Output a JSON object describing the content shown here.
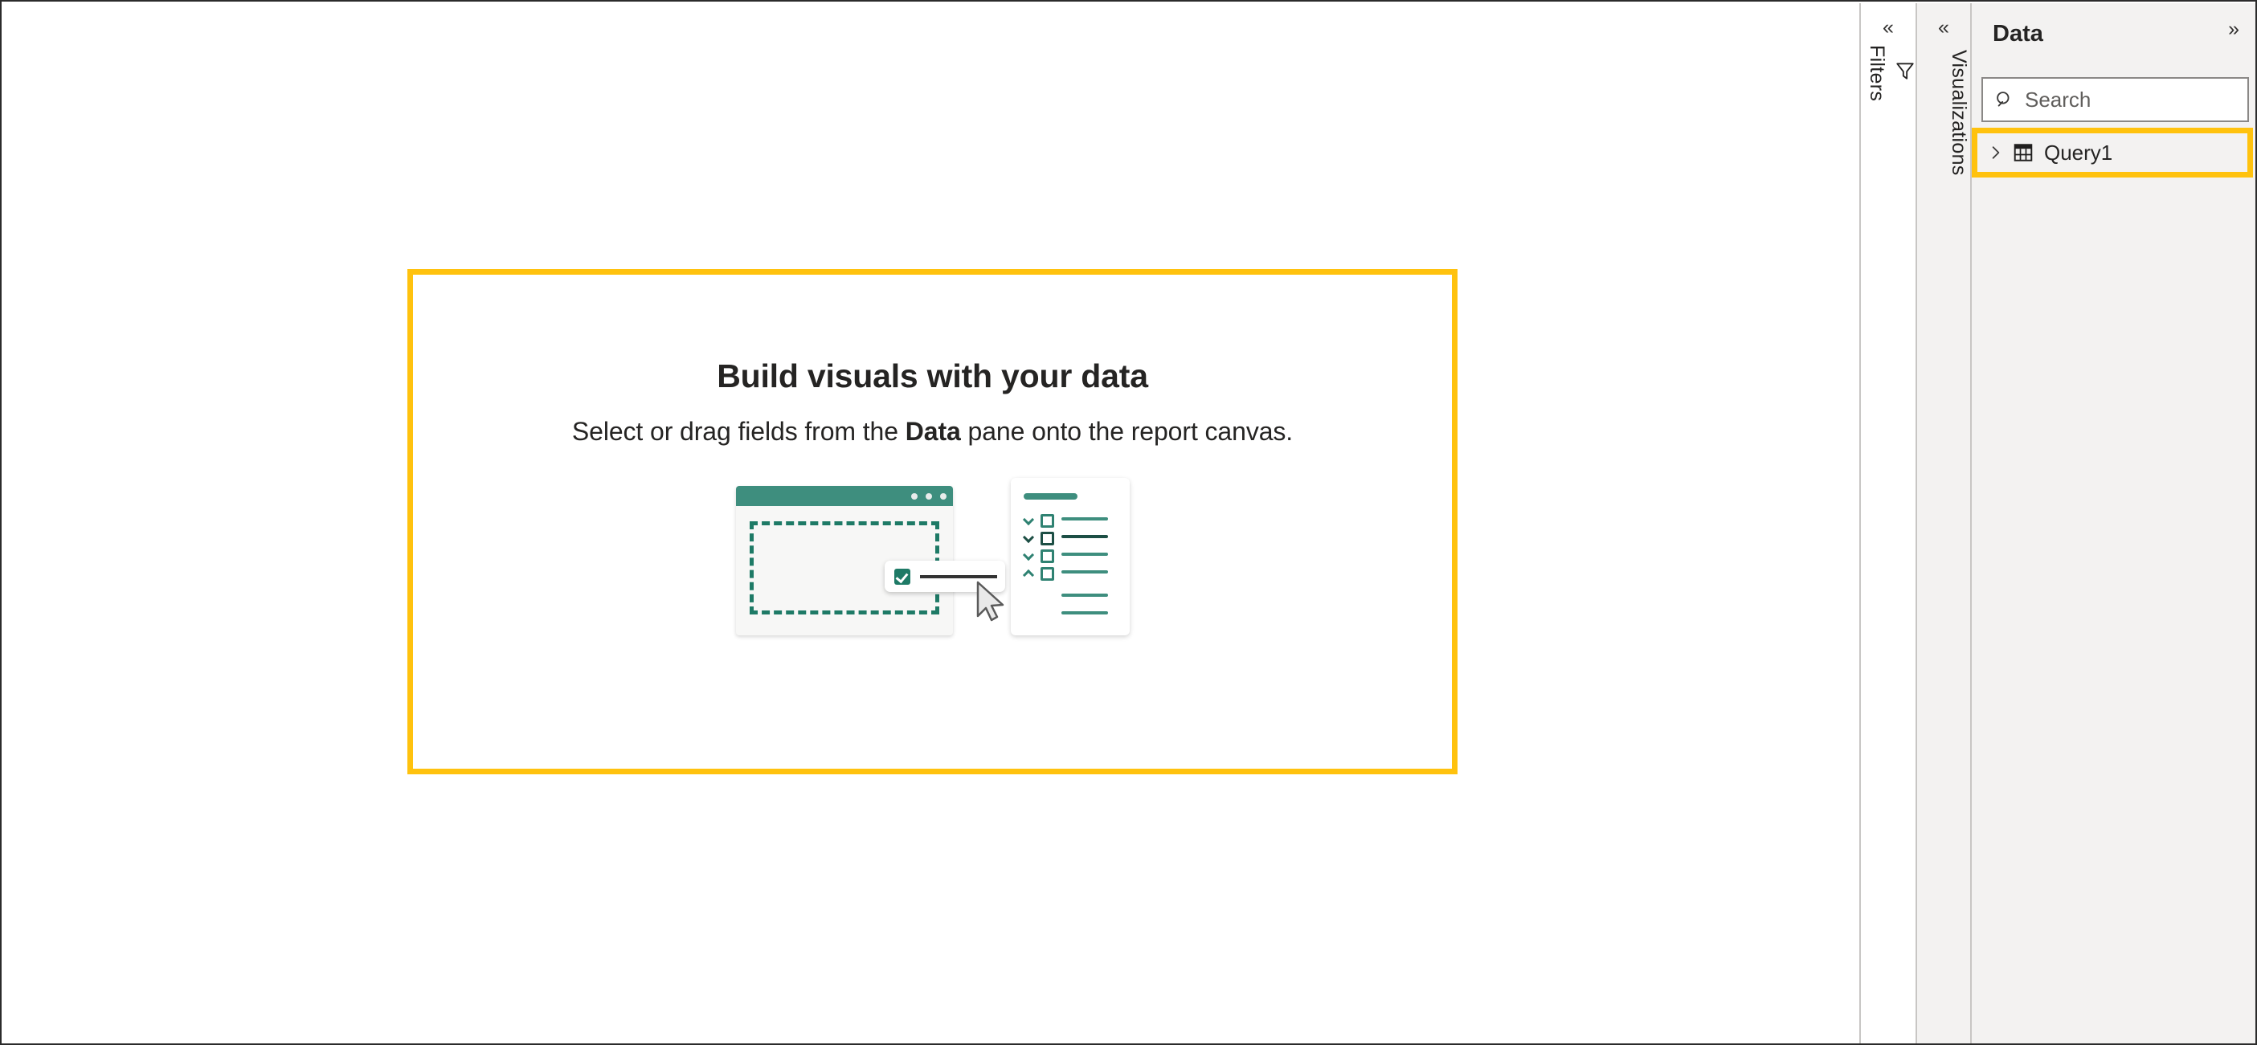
{
  "canvas": {
    "empty_state": {
      "title": "Build visuals with your data",
      "subtitle_before": "Select or drag fields from the ",
      "subtitle_bold": "Data",
      "subtitle_after": " pane onto the report canvas.",
      "highlight_color": "#FFC20E",
      "illustration": {
        "accent_color": "#3E8E7E",
        "dropzone_color": "#1E7A66",
        "cursor_name": "mouse-pointer",
        "window_dots": 3,
        "field_rows": 4,
        "field_sublines": 2
      }
    }
  },
  "filters_rail": {
    "collapse_icon": "chevron-double-left",
    "label": "Filters",
    "icon": "filter-icon"
  },
  "visualizations_rail": {
    "collapse_icon": "chevron-double-left",
    "label": "Visualizations"
  },
  "data_pane": {
    "title": "Data",
    "expand_icon": "chevron-double-right",
    "search": {
      "placeholder": "Search",
      "value": "",
      "icon": "search-icon"
    },
    "highlight_color": "#FFC20E",
    "tables": [
      {
        "name": "Query1",
        "expanded": false,
        "chevron_icon": "chevron-right",
        "icon": "table-icon"
      }
    ]
  }
}
